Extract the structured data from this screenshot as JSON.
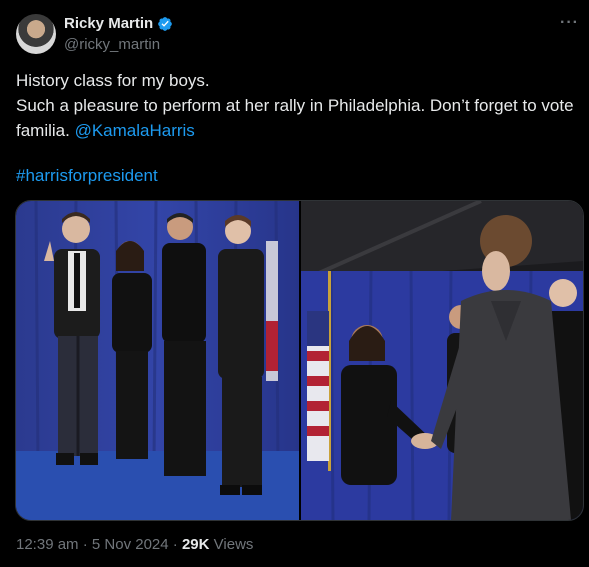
{
  "author": {
    "display_name": "Ricky Martin",
    "handle": "@ricky_martin",
    "verified": true,
    "verified_icon": "verified-badge-icon",
    "verified_color": "#1d9bf0"
  },
  "more_label": "···",
  "tweet": {
    "line1": "History class for my boys.",
    "line2_prefix": "Such a pleasure to perform at her rally in Philadelphia. Don’t forget to vote familia. ",
    "mention": "@KamalaHarris",
    "hashtag": "#harrisforpresident"
  },
  "media": {
    "count": 2,
    "photo_1_icon": "group-photo-image",
    "photo_2_icon": "handshake-photo-image"
  },
  "meta": {
    "time": "12:39 am",
    "separator": " · ",
    "date": "5 Nov 2024",
    "views_count": "29K",
    "views_label": " Views"
  },
  "colors": {
    "background": "#000000",
    "text": "#e7e9ea",
    "secondary": "#71767b",
    "link": "#1d9bf0"
  }
}
